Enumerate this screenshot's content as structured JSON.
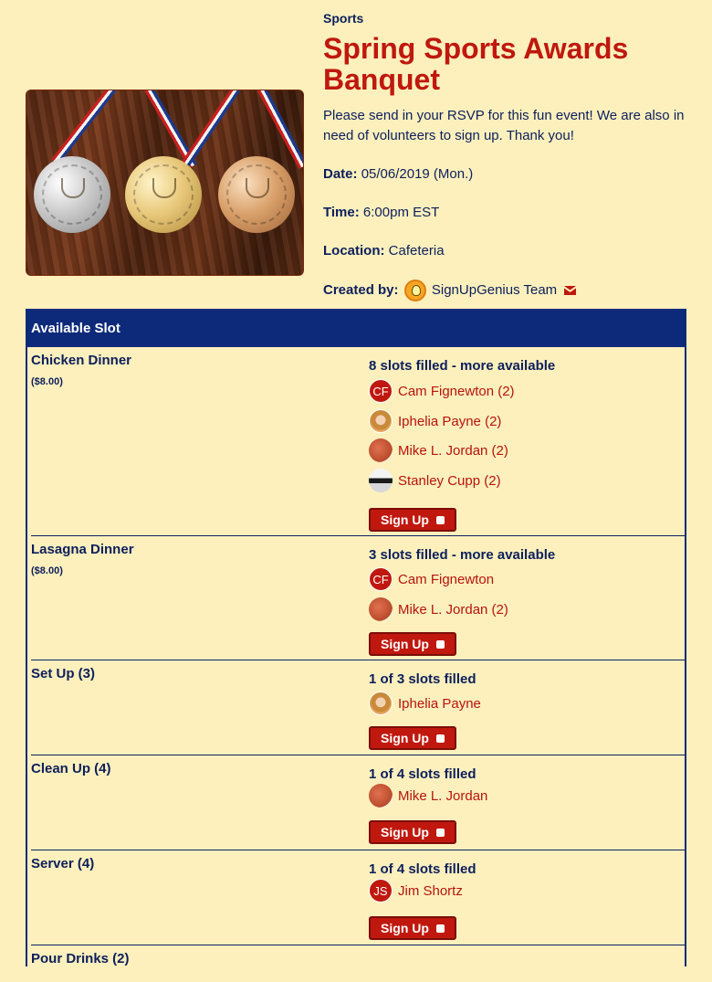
{
  "event": {
    "category": "Sports",
    "title": "Spring Sports Awards Banquet",
    "description": "Please send in your RSVP for this fun event! We are also in need of volunteers to sign up. Thank you!",
    "date_label": "Date:",
    "date_value": "05/06/2019 (Mon.)",
    "time_label": "Time:",
    "time_value": "6:00pm EST",
    "location_label": "Location:",
    "location_value": "Cafeteria",
    "created_label": "Created by:",
    "created_value": "SignUpGenius Team"
  },
  "table": {
    "header": "Available Slot",
    "signup_label": "Sign Up",
    "rows": [
      {
        "name": "Chicken Dinner",
        "price": "($8.00)",
        "status": "8 slots filled - more available",
        "people": [
          {
            "initials": "CF",
            "name": "Cam Fignewton (2)"
          },
          {
            "name": "Iphelia Payne (2)"
          },
          {
            "name": "Mike L. Jordan (2)"
          },
          {
            "name": "Stanley Cupp (2)"
          }
        ]
      },
      {
        "name": "Lasagna Dinner",
        "price": "($8.00)",
        "status": "3 slots filled - more available",
        "people": [
          {
            "initials": "CF",
            "name": "Cam Fignewton"
          },
          {
            "name": "Mike L. Jordan (2)"
          }
        ]
      },
      {
        "name": "Set Up (3)",
        "status": "1 of 3 slots filled",
        "people": [
          {
            "name": "Iphelia Payne"
          }
        ]
      },
      {
        "name": "Clean Up (4)",
        "status": "1 of 4 slots filled",
        "people": [
          {
            "name": "Mike L. Jordan"
          }
        ]
      },
      {
        "name": "Server (4)",
        "status": "1 of 4 slots filled",
        "people": [
          {
            "initials": "JS",
            "name": "Jim Shortz"
          }
        ]
      },
      {
        "name": "Pour Drinks (2)"
      }
    ]
  }
}
